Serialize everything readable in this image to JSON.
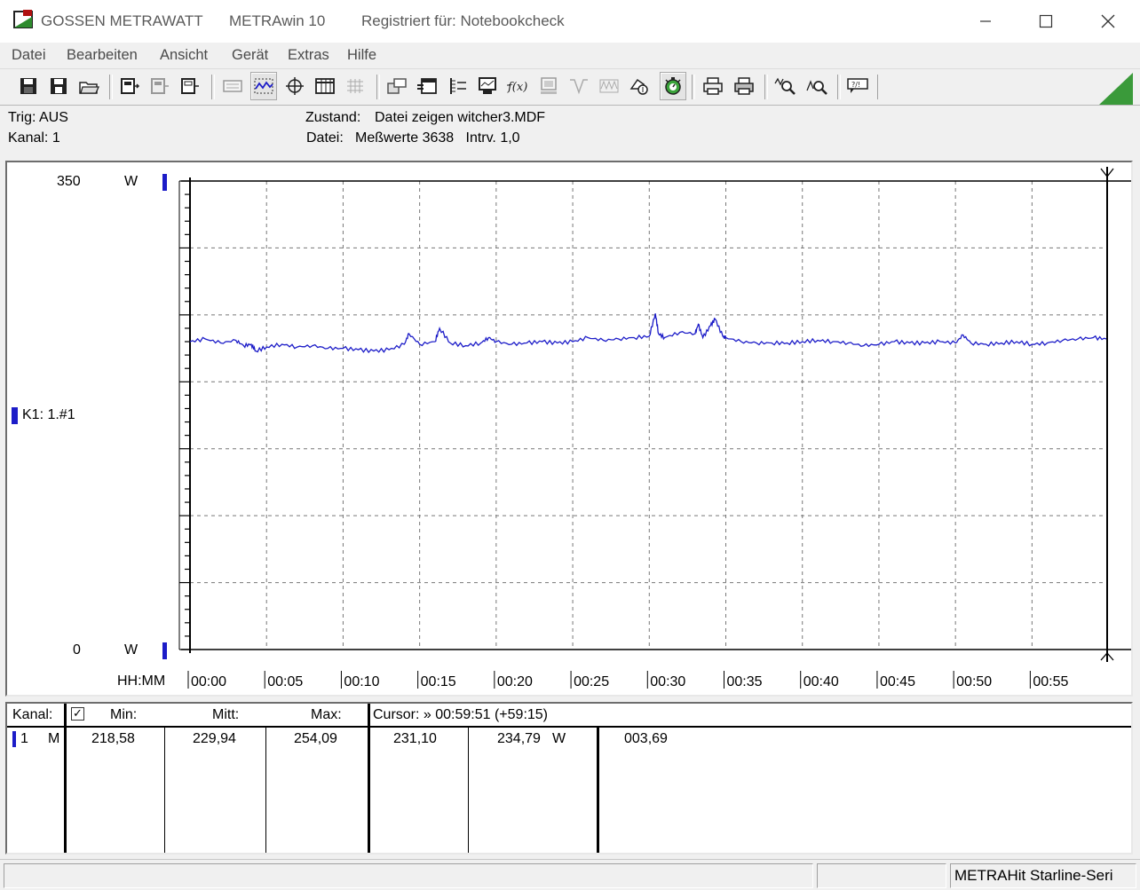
{
  "titlebar": {
    "brand": "GOSSEN METRAWATT",
    "app": "METRAwin 10",
    "registered": "Registriert für: Notebookcheck"
  },
  "menu": [
    "Datei",
    "Bearbeiten",
    "Ansicht",
    "Gerät",
    "Extras",
    "Hilfe"
  ],
  "status": {
    "trig": "Trig: AUS",
    "kanal": "Kanal: 1",
    "zustand_label": "Zustand:",
    "zustand_value": "Datei zeigen witcher3.MDF",
    "datei_label": "Datei:",
    "datei_value": "Meßwerte 3638   Intrv. 1,0"
  },
  "chart_data": {
    "type": "line",
    "ytop_label": "350",
    "ybottom_label": "0",
    "yunit": "W",
    "channel_label": "K1: 1.#1",
    "xaxis_label": "HH:MM",
    "ylim": [
      0,
      350
    ],
    "xlim": [
      0,
      59.85
    ],
    "x_ticks": [
      "00:00",
      "00:05",
      "00:10",
      "00:15",
      "00:20",
      "00:25",
      "00:30",
      "00:35",
      "00:40",
      "00:45",
      "00:50",
      "00:55"
    ],
    "grid": true,
    "line_color": "#1c1cc8",
    "series": [
      {
        "x": [
          0,
          1,
          2,
          3,
          3.5,
          4,
          4.3,
          5,
          6,
          7,
          8,
          9,
          10,
          11,
          12,
          13,
          14,
          14.3,
          15,
          16,
          16.3,
          17,
          18,
          19,
          19.5,
          20,
          21,
          22,
          23,
          24,
          25,
          26,
          27,
          28,
          29,
          30,
          30.4,
          30.6,
          31,
          32,
          33,
          33.2,
          33.5,
          34,
          34.3,
          34.8,
          35,
          36,
          37,
          38,
          39,
          40,
          41,
          42,
          43,
          44,
          45,
          46,
          47,
          48,
          49,
          50,
          50.5,
          51,
          52,
          53,
          54,
          55,
          56,
          57,
          58,
          59,
          59.85
        ],
        "y": [
          230,
          232,
          229,
          231,
          227,
          228,
          223,
          226,
          228,
          226,
          227,
          225,
          225,
          224,
          223,
          224,
          228,
          236,
          228,
          230,
          240,
          229,
          227,
          229,
          233,
          230,
          228,
          229,
          230,
          229,
          230,
          233,
          231,
          232,
          233,
          234,
          251,
          236,
          233,
          237,
          236,
          243,
          233,
          242,
          247,
          234,
          233,
          230,
          229,
          229,
          229,
          230,
          231,
          230,
          229,
          227,
          228,
          230,
          229,
          229,
          230,
          229,
          235,
          229,
          228,
          229,
          230,
          228,
          229,
          231,
          232,
          233,
          232
        ]
      }
    ]
  },
  "table": {
    "headers": {
      "kanal": "Kanal:",
      "check": "✓",
      "min": "Min:",
      "mitt": "Mitt:",
      "max": "Max:",
      "cursor": "Cursor: » 00:59:51 (+59:15)"
    },
    "row": {
      "channel": "1",
      "mode": "M",
      "min": "218,58",
      "mitt": "229,94",
      "max": "254,09",
      "cursor1": "231,10",
      "cursor2": "234,79",
      "unit": "W",
      "delta": "003,69"
    }
  },
  "statusbar": {
    "device": "METRAHit Starline-Seri"
  },
  "colors": {
    "accent_green": "#3a9a3a",
    "channel_blue": "#1c1cc8"
  }
}
